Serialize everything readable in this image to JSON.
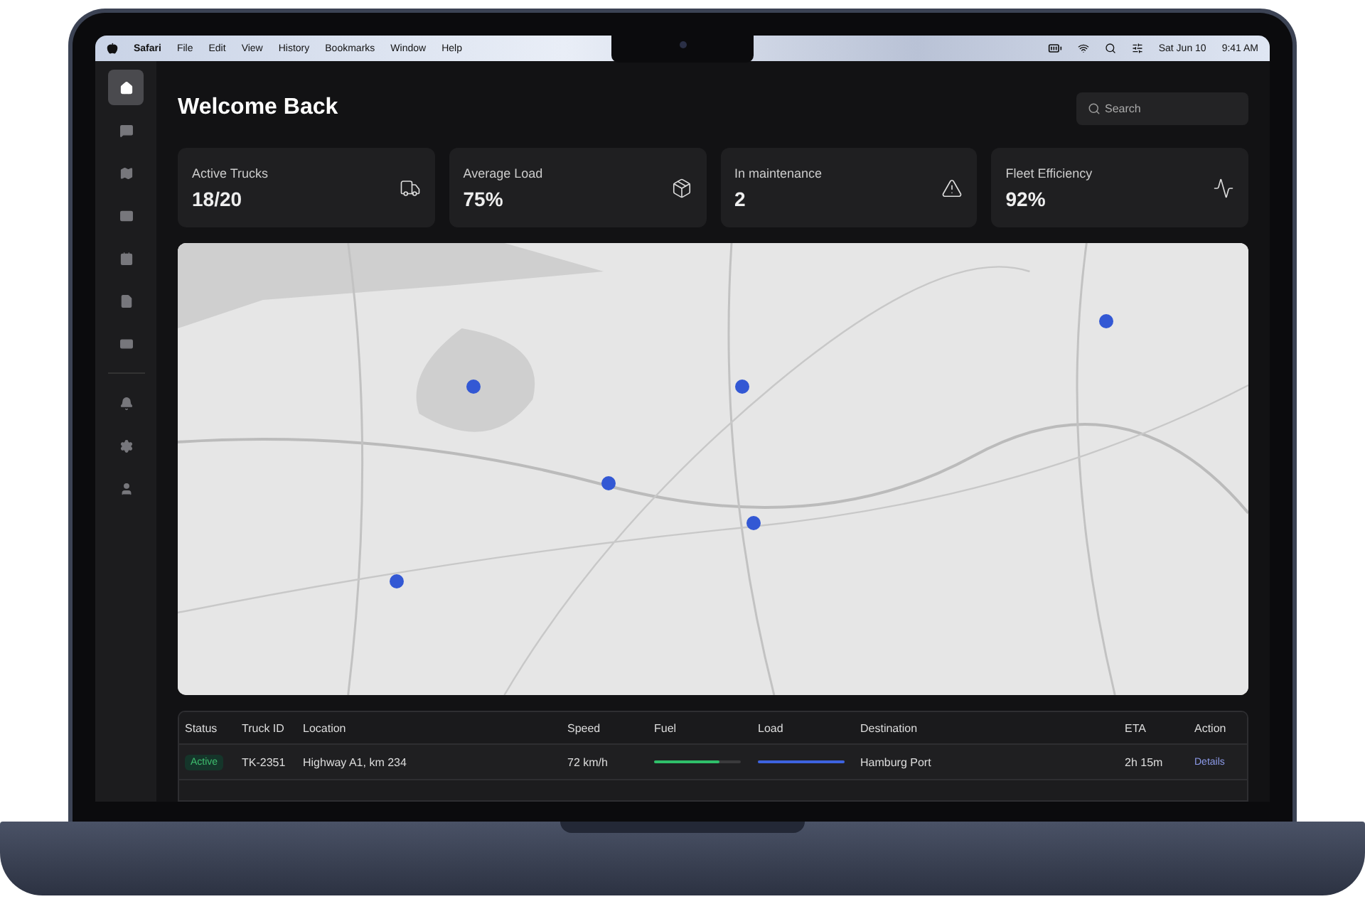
{
  "menu_bar": {
    "app": "Safari",
    "menus": [
      "File",
      "Edit",
      "View",
      "History",
      "Bookmarks",
      "Window",
      "Help"
    ],
    "date": "Sat Jun 10",
    "time": "9:41 AM"
  },
  "sidebar": {
    "items": [
      {
        "kind": "home",
        "selected": true
      },
      {
        "kind": "messages",
        "selected": false
      },
      {
        "kind": "map",
        "selected": false
      },
      {
        "kind": "mail",
        "selected": false
      },
      {
        "kind": "calendar",
        "selected": false
      },
      {
        "kind": "document",
        "selected": false
      },
      {
        "kind": "card",
        "selected": false
      },
      {
        "kind": "divider"
      },
      {
        "kind": "bell",
        "selected": false
      },
      {
        "kind": "settings",
        "selected": false
      },
      {
        "kind": "user",
        "selected": false
      }
    ]
  },
  "header": {
    "title": "Welcome Back",
    "search": {
      "placeholder": "Search"
    }
  },
  "stats": [
    {
      "kind": "truck",
      "label": "Active Trucks",
      "value": "18/20"
    },
    {
      "kind": "box",
      "label": "Average Load",
      "value": "75%"
    },
    {
      "kind": "warning",
      "label": "In maintenance",
      "value": "2"
    },
    {
      "kind": "pulse",
      "label": "Fleet Efficiency",
      "value": "92%"
    }
  ],
  "table": {
    "columns": [
      "Status",
      "Truck ID",
      "Location",
      "Speed",
      "Fuel",
      "Load",
      "Destination",
      "ETA",
      "Action"
    ],
    "rows": [
      {
        "status": "Active",
        "truck_id": "TK-2351",
        "location": "Highway A1, km 234",
        "speed": "72 km/h",
        "fuel": {
          "level": 0.75
        },
        "load": {
          "level": 1
        },
        "destination": "Hamburg Port",
        "eta": "2h 15m",
        "action": "Details"
      }
    ]
  }
}
